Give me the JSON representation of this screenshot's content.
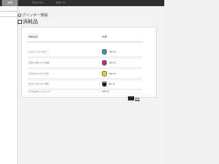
{
  "tabs": [
    {
      "label": "状態",
      "active": true
    },
    {
      "label": "プロパティ",
      "active": false
    },
    {
      "label": "サポート",
      "active": false
    }
  ],
  "breadcrumb": "プリンター情報",
  "page_title": "消耗品",
  "table": {
    "headers": {
      "name": "消耗品名",
      "status": "状態"
    },
    "rows": [
      {
        "name": "シアントナー(C)",
        "level": 100,
        "level_text": "100 %",
        "color": "#1aa0b8"
      },
      {
        "name": "マゼンタトナー(M)",
        "level": 100,
        "level_text": "100 %",
        "color": "#c4227d"
      },
      {
        "name": "イエロートナー(Y)",
        "level": 100,
        "level_text": "100 %",
        "color": "#e8d21c"
      },
      {
        "name": "ブラックトナー(K)",
        "level": 80,
        "level_text": "80 %",
        "color": "#141414"
      },
      {
        "name": "ドラムカートリッジ",
        "level_text": "100 %"
      }
    ]
  },
  "ok_link": {
    "icon": "ok-icon",
    "label": "更新"
  }
}
